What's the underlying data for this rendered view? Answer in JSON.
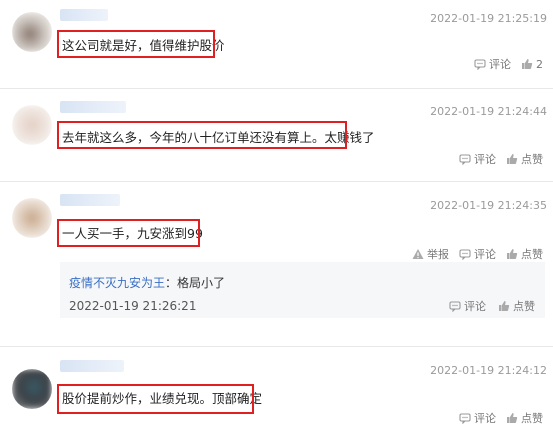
{
  "comments": [
    {
      "text": "这公司就是好，值得维护股价",
      "time": "2022-01-19 21:25:19",
      "comment_label": "评论",
      "like_count": "2"
    },
    {
      "text": "去年就这么多，今年的八十亿订单还没有算上。太赚钱了",
      "time": "2022-01-19 21:24:44",
      "comment_label": "评论",
      "like_label": "点赞"
    },
    {
      "text": "一人买一手，九安涨到99",
      "time": "2022-01-19 21:24:35",
      "report_label": "举报",
      "comment_label": "评论",
      "like_label": "点赞",
      "reply": {
        "user": "疫情不灭九安为王",
        "separator": "：",
        "text": "格局小了",
        "time": "2022-01-19 21:26:21",
        "comment_label": "评论",
        "like_label": "点赞"
      }
    },
    {
      "text": "股价提前炒作，业绩兑现。顶部确定",
      "time": "2022-01-19 21:24:12",
      "comment_label": "评论",
      "like_label": "点赞"
    }
  ],
  "colors": {
    "highlight_box": "#e02020",
    "reply_user": "#3b6fc4"
  },
  "icons": {
    "comment": "comment-bubble-icon",
    "like": "thumbs-up-icon",
    "report": "warning-triangle-icon"
  }
}
